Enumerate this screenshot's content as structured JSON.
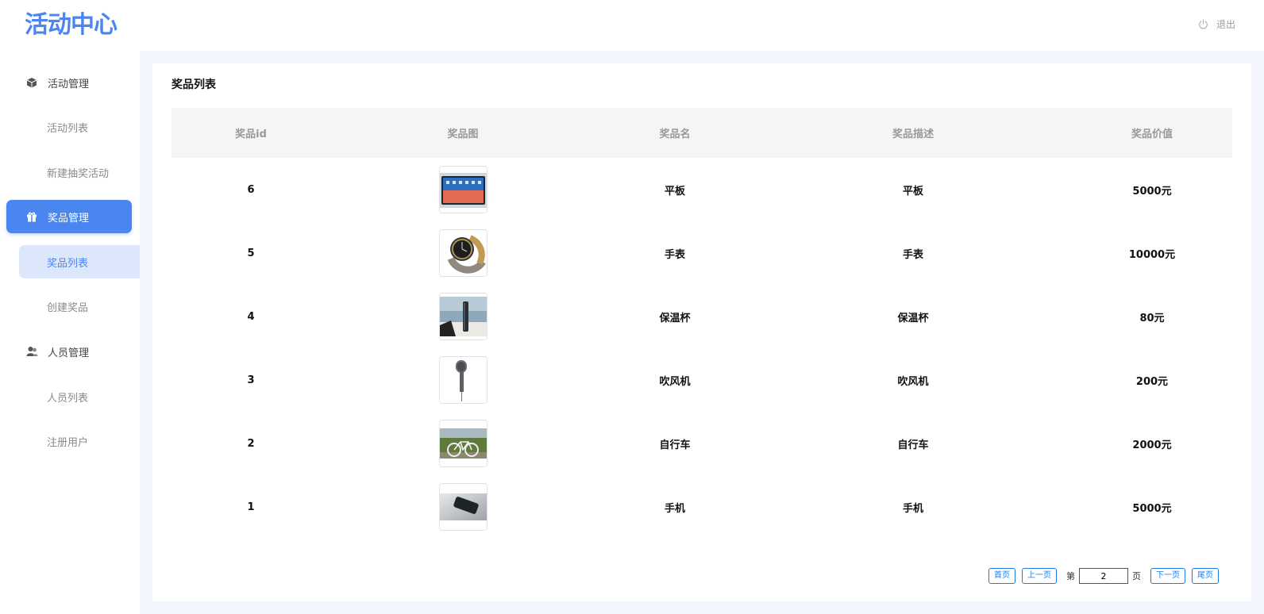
{
  "header": {
    "logo": "活动中心",
    "logout_label": "退出"
  },
  "sidebar": {
    "groups": [
      {
        "label": "活动管理",
        "icon": "cube-icon",
        "items": [
          {
            "label": "活动列表"
          },
          {
            "label": "新建抽奖活动"
          }
        ]
      },
      {
        "label": "奖品管理",
        "icon": "gift-icon",
        "active": true,
        "items": [
          {
            "label": "奖品列表",
            "active": true
          },
          {
            "label": "创建奖品"
          }
        ]
      },
      {
        "label": "人员管理",
        "icon": "users-icon",
        "items": [
          {
            "label": "人员列表"
          },
          {
            "label": "注册用户"
          }
        ]
      }
    ]
  },
  "main": {
    "title": "奖品列表",
    "columns": [
      "奖品id",
      "奖品图",
      "奖品名",
      "奖品描述",
      "奖品价值"
    ],
    "rows": [
      {
        "id": "6",
        "image": "tablet-photo",
        "name": "平板",
        "desc": "平板",
        "value": "5000元"
      },
      {
        "id": "5",
        "image": "watch-photo",
        "name": "手表",
        "desc": "手表",
        "value": "10000元"
      },
      {
        "id": "4",
        "image": "thermos-photo",
        "name": "保温杯",
        "desc": "保温杯",
        "value": "80元"
      },
      {
        "id": "3",
        "image": "hairdryer-photo",
        "name": "吹风机",
        "desc": "吹风机",
        "value": "200元"
      },
      {
        "id": "2",
        "image": "bicycle-photo",
        "name": "自行车",
        "desc": "自行车",
        "value": "2000元"
      },
      {
        "id": "1",
        "image": "phone-photo",
        "name": "手机",
        "desc": "手机",
        "value": "5000元"
      }
    ]
  },
  "pagination": {
    "first": "首页",
    "prev": "上一页",
    "page_prefix": "第",
    "page_value": "2",
    "page_suffix": "页",
    "next": "下一页",
    "last": "尾页"
  },
  "colors": {
    "accent": "#4b86f0",
    "accent_light": "#dce7fc",
    "pager_blue": "#1e7ce6"
  }
}
